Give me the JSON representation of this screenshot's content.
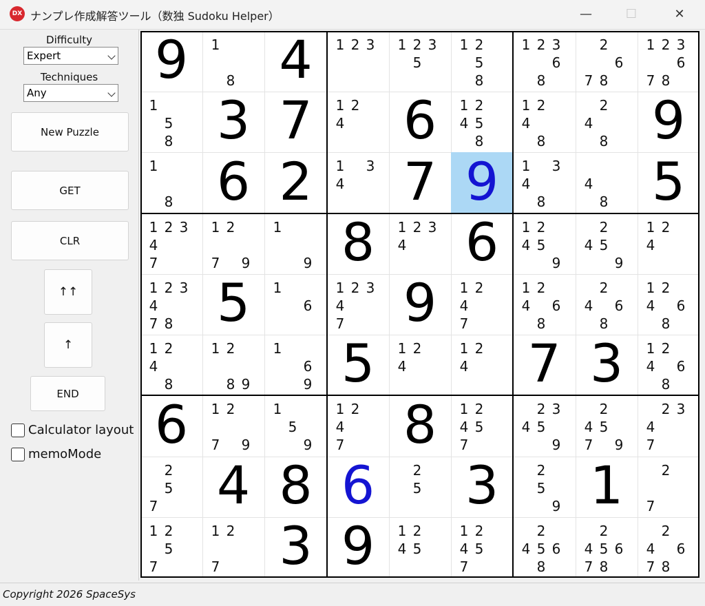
{
  "window": {
    "title": "ナンプレ作成解答ツール（数独 Sudoku Helper）",
    "icon_text": "DX",
    "minimize_glyph": "—",
    "maximize_glyph": "☐",
    "close_glyph": "✕"
  },
  "sidebar": {
    "difficulty_label": "Difficulty",
    "difficulty_value": "Expert",
    "techniques_label": "Techniques",
    "techniques_value": "Any",
    "new_puzzle": "New Puzzle",
    "get": "GET",
    "clr": "CLR",
    "up_up": "↑↑",
    "up": "↑",
    "end": "END",
    "calculator_layout": "Calculator layout",
    "memo_mode": "memoMode"
  },
  "status": {
    "copyright": "Copyright 2026 SpaceSys"
  },
  "colors": {
    "given": "#000000",
    "user": "#1414d2",
    "selected_bg": "#acd8f5"
  },
  "selected": [
    2,
    5
  ],
  "cells": [
    [
      {
        "v": "9"
      },
      {
        "n": [
          1,
          8
        ]
      },
      {
        "v": "4"
      },
      {
        "n": [
          1,
          2,
          3
        ]
      },
      {
        "n": [
          1,
          2,
          3,
          5
        ]
      },
      {
        "n": [
          1,
          2,
          5,
          8
        ]
      },
      {
        "n": [
          1,
          2,
          3,
          6,
          8
        ]
      },
      {
        "n": [
          2,
          6,
          7,
          8
        ]
      },
      {
        "n": [
          1,
          2,
          3,
          6,
          7,
          8
        ]
      }
    ],
    [
      {
        "n": [
          1,
          5,
          8
        ]
      },
      {
        "v": "3"
      },
      {
        "v": "7"
      },
      {
        "n": [
          1,
          2,
          4
        ]
      },
      {
        "v": "6"
      },
      {
        "n": [
          1,
          2,
          4,
          5,
          8
        ]
      },
      {
        "n": [
          1,
          2,
          4,
          8
        ]
      },
      {
        "n": [
          2,
          4,
          8
        ]
      },
      {
        "v": "9"
      }
    ],
    [
      {
        "n": [
          1,
          8
        ]
      },
      {
        "v": "6"
      },
      {
        "v": "2"
      },
      {
        "n": [
          1,
          3,
          4
        ]
      },
      {
        "v": "7"
      },
      {
        "v": "9",
        "u": true
      },
      {
        "n": [
          1,
          3,
          4,
          8
        ]
      },
      {
        "n": [
          4,
          8
        ]
      },
      {
        "v": "5"
      }
    ],
    [
      {
        "n": [
          1,
          2,
          3,
          4,
          7
        ]
      },
      {
        "n": [
          1,
          2,
          7,
          9
        ]
      },
      {
        "n": [
          1,
          9
        ]
      },
      {
        "v": "8"
      },
      {
        "n": [
          1,
          2,
          3,
          4
        ]
      },
      {
        "v": "6"
      },
      {
        "n": [
          1,
          2,
          4,
          5,
          9
        ]
      },
      {
        "n": [
          2,
          4,
          5,
          9
        ]
      },
      {
        "n": [
          1,
          2,
          4
        ]
      }
    ],
    [
      {
        "n": [
          1,
          2,
          3,
          4,
          7,
          8
        ]
      },
      {
        "v": "5"
      },
      {
        "n": [
          1,
          6
        ]
      },
      {
        "n": [
          1,
          2,
          3,
          4,
          7
        ]
      },
      {
        "v": "9"
      },
      {
        "n": [
          1,
          2,
          4,
          7
        ]
      },
      {
        "n": [
          1,
          2,
          4,
          6,
          8
        ]
      },
      {
        "n": [
          2,
          4,
          6,
          8
        ]
      },
      {
        "n": [
          1,
          2,
          4,
          6,
          8
        ]
      }
    ],
    [
      {
        "n": [
          1,
          2,
          4,
          8
        ]
      },
      {
        "n": [
          1,
          2,
          8,
          9
        ]
      },
      {
        "n": [
          1,
          6,
          9
        ]
      },
      {
        "v": "5"
      },
      {
        "n": [
          1,
          2,
          4
        ]
      },
      {
        "n": [
          1,
          2,
          4
        ]
      },
      {
        "v": "7"
      },
      {
        "v": "3"
      },
      {
        "n": [
          1,
          2,
          4,
          6,
          8
        ]
      }
    ],
    [
      {
        "v": "6"
      },
      {
        "n": [
          1,
          2,
          7,
          9
        ]
      },
      {
        "n": [
          1,
          5,
          9
        ]
      },
      {
        "n": [
          1,
          2,
          4,
          7
        ]
      },
      {
        "v": "8"
      },
      {
        "n": [
          1,
          2,
          4,
          5,
          7
        ]
      },
      {
        "n": [
          2,
          3,
          4,
          5,
          9
        ]
      },
      {
        "n": [
          2,
          4,
          5,
          7,
          9
        ]
      },
      {
        "n": [
          2,
          3,
          4,
          7
        ]
      }
    ],
    [
      {
        "n": [
          2,
          5,
          7
        ]
      },
      {
        "v": "4"
      },
      {
        "v": "8"
      },
      {
        "v": "6",
        "u": true
      },
      {
        "n": [
          2,
          5
        ]
      },
      {
        "v": "3"
      },
      {
        "n": [
          2,
          5,
          9
        ]
      },
      {
        "v": "1"
      },
      {
        "n": [
          2,
          7
        ]
      }
    ],
    [
      {
        "n": [
          1,
          2,
          5,
          7
        ]
      },
      {
        "n": [
          1,
          2,
          7
        ]
      },
      {
        "v": "3"
      },
      {
        "v": "9"
      },
      {
        "n": [
          1,
          2,
          4,
          5
        ]
      },
      {
        "n": [
          1,
          2,
          4,
          5,
          7
        ]
      },
      {
        "n": [
          2,
          4,
          5,
          6,
          8
        ]
      },
      {
        "n": [
          2,
          4,
          5,
          6,
          7,
          8
        ]
      },
      {
        "n": [
          2,
          4,
          6,
          7,
          8
        ]
      }
    ]
  ]
}
